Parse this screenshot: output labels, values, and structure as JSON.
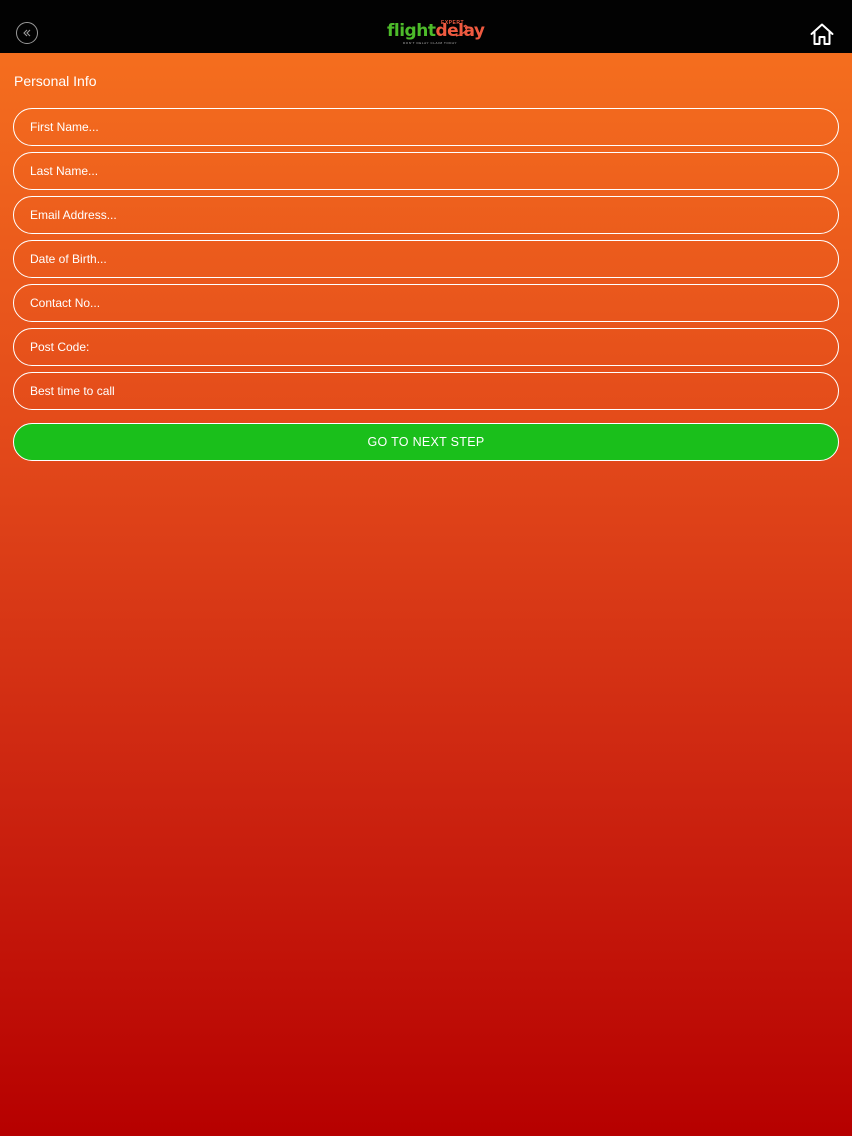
{
  "header": {
    "back_icon": "chevron-double-left-icon",
    "logo": {
      "word_flight": "flight",
      "word_delay": "delay",
      "word_expert": "EXPERT",
      "tagline": "DON'T DELAY CLAIM TODAY"
    },
    "home_icon": "home-icon"
  },
  "form": {
    "title": "Personal Info",
    "fields": {
      "first_name": "First Name...",
      "last_name": "Last Name...",
      "email": "Email Address...",
      "dob": "Date of Birth...",
      "contact": "Contact No...",
      "postcode": "Post Code:",
      "best_time": "Best time to call"
    },
    "submit_label": "GO TO NEXT STEP"
  },
  "colors": {
    "topbar": "#020202",
    "gradient_top": "#f7731f",
    "gradient_bottom": "#b60000",
    "button": "#1abf1b",
    "logo_green": "#4dbb2a",
    "logo_red": "#ef5a40"
  }
}
